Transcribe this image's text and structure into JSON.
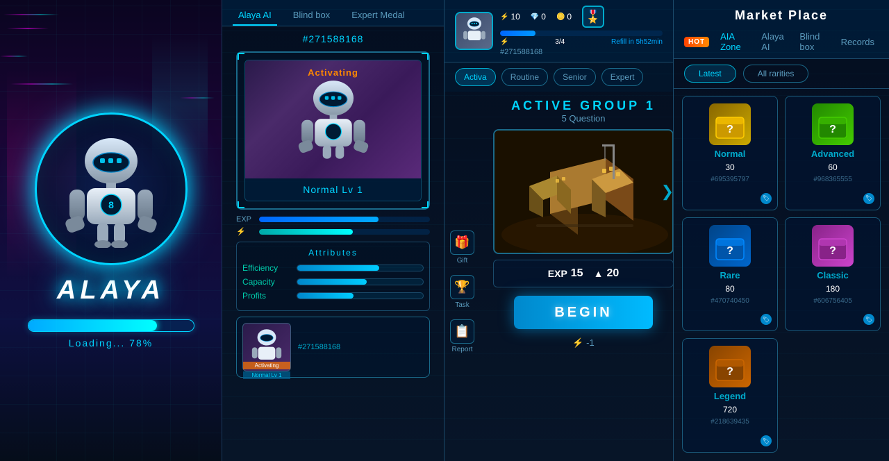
{
  "loading": {
    "title": "ALAYA",
    "bar_percent": 78,
    "bar_width": "78%",
    "loading_text": "Loading... 78%"
  },
  "alaya_ai": {
    "tabs": [
      {
        "label": "Alaya AI",
        "active": true
      },
      {
        "label": "Blind box",
        "active": false
      },
      {
        "label": "Expert Medal",
        "active": false
      }
    ],
    "card_id": "#271588168",
    "status": "Activating",
    "level": "Normal Lv 1",
    "exp_label": "EXP",
    "attributes": {
      "title": "Attributes",
      "items": [
        {
          "name": "Efficiency",
          "fill": "65%"
        },
        {
          "name": "Capacity",
          "fill": "55%"
        },
        {
          "name": "Profits",
          "fill": "45%"
        }
      ]
    },
    "bottom_card_id": "#271588168",
    "bottom_status": "Activating",
    "bottom_level": "Normal Lv 1"
  },
  "game": {
    "player_id": "#271588168",
    "stats": {
      "lightning": 10,
      "diamonds": 0,
      "coins": 0
    },
    "exp_text": "9/40",
    "energy_text": "3/4",
    "refill_text": "Refill in 5h52min",
    "action_tabs": [
      "Activa",
      "Routine",
      "Senior",
      "Expert"
    ],
    "group_title": "ACTIVE GROUP 1",
    "group_subtitle": "5 Question",
    "nav_left": "❮",
    "nav_right": "❯",
    "reward_exp": 15,
    "reward_triangle": 20,
    "begin_label": "BEGIN",
    "energy_cost": "⚡ -1",
    "side_actions": [
      {
        "icon": "🎁",
        "label": "Gift"
      },
      {
        "icon": "🏆",
        "label": "Task"
      },
      {
        "icon": "📋",
        "label": "Report"
      }
    ]
  },
  "market": {
    "title": "Market Place",
    "hot_badge": "HOT",
    "tabs": [
      {
        "label": "AIA Zone",
        "active": true
      },
      {
        "label": "Alaya AI",
        "active": false
      },
      {
        "label": "Blind box",
        "active": false
      },
      {
        "label": "Records",
        "active": false
      }
    ],
    "filters": [
      {
        "label": "Latest",
        "active": true
      },
      {
        "label": "All rarities",
        "active": false
      }
    ],
    "cards": [
      {
        "type": "normal",
        "name": "Normal",
        "price": "30",
        "id": "#695395797",
        "box_class": "box-normal"
      },
      {
        "type": "advanced",
        "name": "Advanced",
        "price": "60",
        "id": "#968365555",
        "box_class": "box-advanced"
      },
      {
        "type": "rare",
        "name": "Rare",
        "price": "80",
        "id": "#470740450",
        "box_class": "box-rare"
      },
      {
        "type": "classic",
        "name": "Classic",
        "price": "180",
        "id": "#606756405",
        "box_class": "box-classic"
      },
      {
        "type": "legend",
        "name": "Legend",
        "price": "720",
        "id": "#218639435",
        "box_class": "box-legend"
      }
    ]
  }
}
